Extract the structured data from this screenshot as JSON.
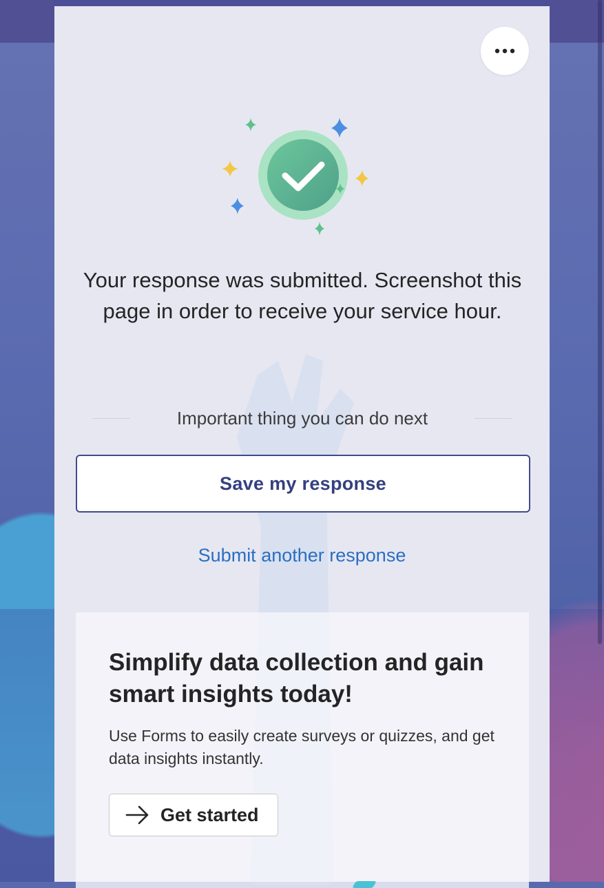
{
  "confirmation": {
    "message": "Your response was submitted. Screenshot this page in order to receive your service hour."
  },
  "next_steps": {
    "label": "Important thing you can do next",
    "save_button": "Save my response",
    "submit_another": "Submit another response"
  },
  "promo": {
    "title": "Simplify data collection and gain smart insights today!",
    "description": "Use Forms to easily create surveys or quizzes, and get data insights instantly.",
    "cta": "Get started"
  },
  "icons": {
    "more": "more-options-icon",
    "success": "checkmark-circle-icon",
    "cta": "arrow-right-icon"
  },
  "colors": {
    "header_bar": "#4b4f97",
    "primary_button_text": "#34407e",
    "link": "#2a6fc1",
    "success_green": "#5bb88f"
  }
}
